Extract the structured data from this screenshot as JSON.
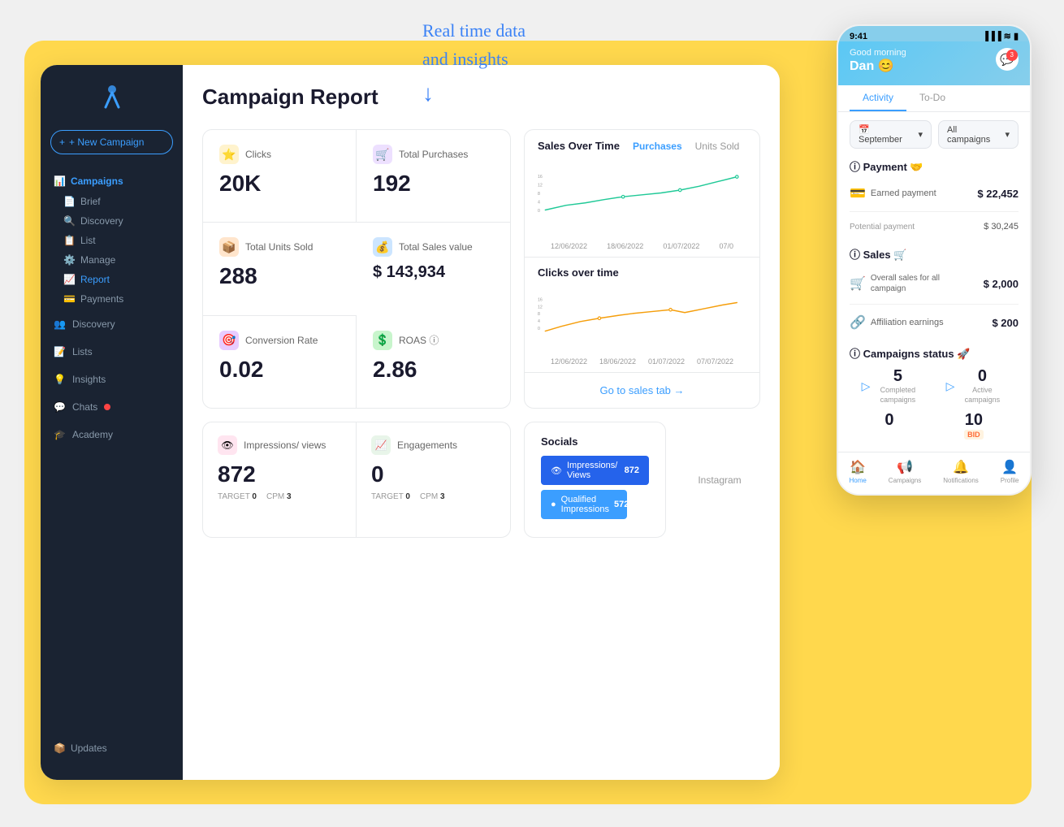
{
  "annotation": {
    "line1": "Real time data",
    "line2": "and insights",
    "arrow": "↓"
  },
  "sidebar": {
    "logo_alt": "App Logo",
    "new_campaign": "+ New Campaign",
    "campaigns_label": "Campaigns",
    "nav_sub": [
      "Brief",
      "Discovery",
      "List",
      "Manage",
      "Report",
      "Payments"
    ],
    "nav_items": [
      "Discovery",
      "Lists",
      "Insights",
      "Chats",
      "Academy"
    ],
    "updates_label": "Updates"
  },
  "main": {
    "title": "Campaign Report",
    "stats": [
      {
        "icon": "⭐",
        "label": "Clicks",
        "value": "20K",
        "color": "#FFF3CD"
      },
      {
        "icon": "🛒",
        "label": "Total Purchases",
        "value": "192",
        "color": "#EDE0FF"
      },
      {
        "icon": "📦",
        "label": "Total Units Sold",
        "value": "288",
        "color": "#FFE5CC"
      },
      {
        "icon": "💰",
        "label": "Total Sales value",
        "value": "$ 143,934",
        "color": "#CCE5FF"
      },
      {
        "icon": "🎯",
        "label": "Conversion Rate",
        "value": "0.02",
        "color": "#E8CCFF"
      },
      {
        "icon": "💲",
        "label": "ROAS",
        "value": "2.86",
        "color": "#C8F5CC"
      }
    ],
    "chart": {
      "title": "Sales Over Time",
      "tabs": [
        "Purchases",
        "Units Sold"
      ],
      "dates": [
        "12/06/2022",
        "18/06/2022",
        "01/07/2022",
        "07/0"
      ]
    },
    "clicks_chart": {
      "title": "Clicks over time",
      "dates": [
        "12/06/2022",
        "18/06/2022",
        "01/07/2022",
        "07/07/2022"
      ]
    },
    "go_to_sales": "Go to sales tab →",
    "bottom": [
      {
        "label": "Impressions/ views",
        "value": "872",
        "target": "0",
        "cpm": "3"
      },
      {
        "label": "Engagements",
        "value": "0",
        "target": "0",
        "cpm": "3"
      }
    ],
    "socials": {
      "title": "Socials",
      "bars": [
        {
          "label": "Impressions/ Views",
          "value": "872",
          "width": "100%"
        },
        {
          "label": "Qualified Impressions",
          "value": "572",
          "width": "80%"
        }
      ]
    }
  },
  "mobile": {
    "time": "9:41",
    "greeting": "Good morning",
    "name": "Dan 😊",
    "tabs": [
      "Activity",
      "To-Do"
    ],
    "filters": [
      "September",
      "All campaigns"
    ],
    "payment": {
      "title": "Payment",
      "earned_label": "Earned payment",
      "earned_value": "$ 22,452",
      "potential_label": "Potential payment",
      "potential_value": "$ 30,245"
    },
    "sales": {
      "title": "Sales",
      "overall_label": "Overall sales for all campaign",
      "overall_value": "$ 2,000",
      "affiliation_label": "Affiliation earnings",
      "affiliation_value": "$ 200"
    },
    "campaigns_status": {
      "title": "Campaigns status",
      "completed_num": "5",
      "completed_label": "Completed campaigns",
      "active_num": "0",
      "active_label": "Active campaigns",
      "zero_num": "0",
      "ten_num": "10"
    },
    "nav": [
      "Home",
      "Campaigns",
      "Notifications",
      "Profile"
    ]
  }
}
